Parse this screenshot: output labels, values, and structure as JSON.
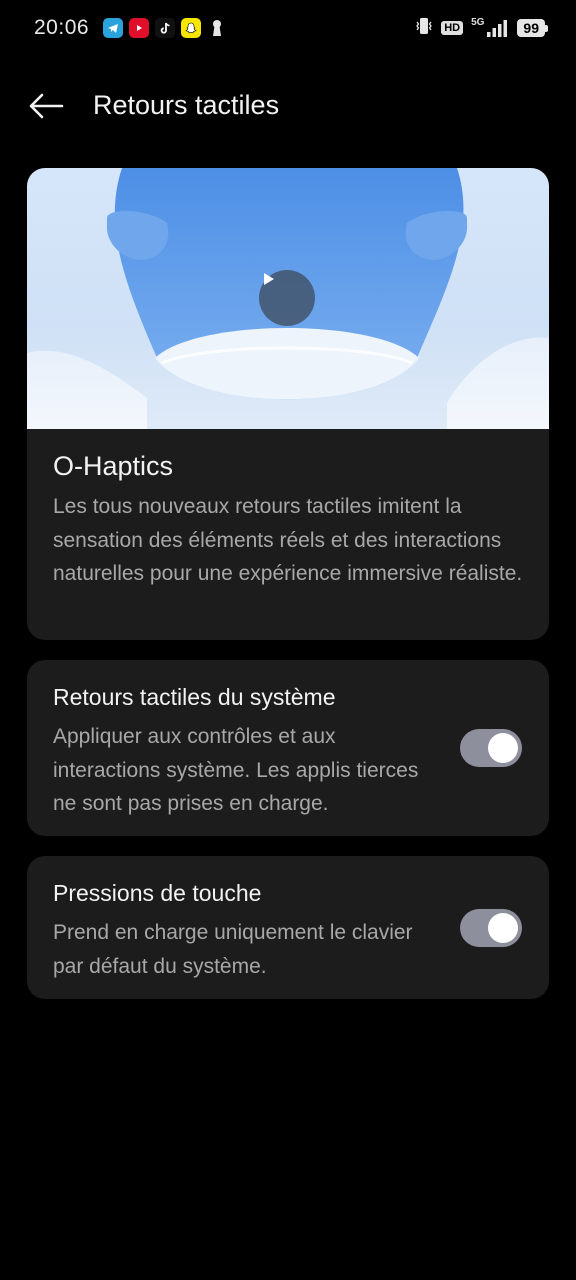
{
  "status_bar": {
    "time": "20:06",
    "apps": [
      "telegram-icon",
      "youtube-icon",
      "tiktok-icon",
      "snapchat-icon",
      "keyhole-icon"
    ],
    "hd_label": "HD",
    "network_label": "5G",
    "battery_level": "99"
  },
  "header": {
    "title": "Retours tactiles"
  },
  "hero": {
    "title": "O-Haptics",
    "description": "Les tous nouveaux retours tactiles imitent la sensation des éléments réels et des interactions naturelles pour une expérience immersive réaliste."
  },
  "settings": [
    {
      "title": "Retours tactiles du système",
      "description": "Appliquer aux contrôles et aux interactions système. Les applis tierces ne sont pas prises en charge.",
      "enabled": true
    },
    {
      "title": "Pressions de touche",
      "description": "Prend en charge uniquement le clavier par défaut du système.",
      "enabled": true
    }
  ],
  "colors": {
    "background": "#000000",
    "card": "#1c1c1c",
    "toggle_track": "#8d8f9c",
    "secondary_text": "#a8a8a8"
  }
}
